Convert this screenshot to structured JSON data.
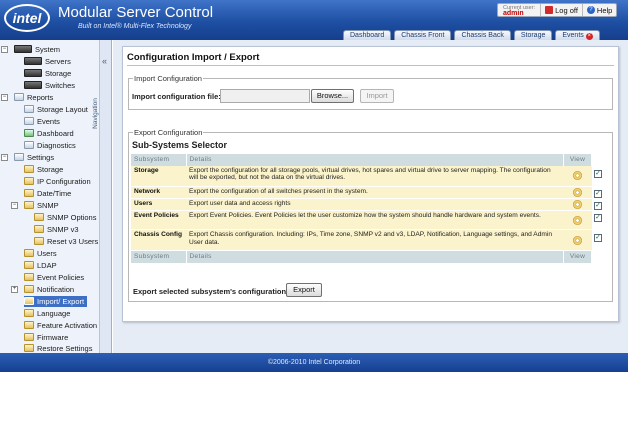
{
  "header": {
    "logo": "intel",
    "title": "Modular Server Control",
    "subtitle": "Built on Intel® Multi-Flex Technology",
    "current_user_label": "Current user:",
    "current_user": "admin",
    "logoff": "Log off",
    "help": "Help",
    "help_icon": "?"
  },
  "tabs": [
    {
      "label": "Dashboard"
    },
    {
      "label": "Chassis Front"
    },
    {
      "label": "Chassis Back"
    },
    {
      "label": "Storage"
    },
    {
      "label": "Events"
    }
  ],
  "tab_close_icon": "×",
  "sidebar": {
    "nav_label": "Navigation",
    "collapse_icon": "«",
    "items": [
      {
        "label": "System",
        "icon": "chassis-icon"
      },
      {
        "label": "Servers",
        "icon": "server-icon"
      },
      {
        "label": "Storage",
        "icon": "storage-icon"
      },
      {
        "label": "Switches",
        "icon": "switch-icon"
      },
      {
        "label": "Reports",
        "icon": "report-icon"
      },
      {
        "label": "Storage Layout",
        "icon": "layout-icon"
      },
      {
        "label": "Events",
        "icon": "events-icon"
      },
      {
        "label": "Dashboard",
        "icon": "dashboard-icon"
      },
      {
        "label": "Diagnostics",
        "icon": "diagnostics-icon"
      },
      {
        "label": "Settings",
        "icon": "settings-icon"
      },
      {
        "label": "Storage",
        "icon": "folder-icon"
      },
      {
        "label": "IP Configuration",
        "icon": "folder-icon"
      },
      {
        "label": "Date/Time",
        "icon": "folder-icon"
      },
      {
        "label": "SNMP",
        "icon": "folder-icon"
      },
      {
        "label": "SNMP Options",
        "icon": "folder-icon"
      },
      {
        "label": "SNMP v3",
        "icon": "folder-icon"
      },
      {
        "label": "Reset v3 Users",
        "icon": "folder-icon"
      },
      {
        "label": "Users",
        "icon": "folder-icon"
      },
      {
        "label": "LDAP",
        "icon": "folder-icon"
      },
      {
        "label": "Event Policies",
        "icon": "folder-icon"
      },
      {
        "label": "Notification",
        "icon": "folder-icon"
      },
      {
        "label": "Import/ Export",
        "icon": "folder-icon"
      },
      {
        "label": "Language",
        "icon": "folder-icon"
      },
      {
        "label": "Feature Activation",
        "icon": "folder-icon"
      },
      {
        "label": "Firmware",
        "icon": "folder-icon"
      },
      {
        "label": "Restore Settings",
        "icon": "folder-icon"
      }
    ],
    "expanders": {
      "minus": "−",
      "plus": "+"
    }
  },
  "main": {
    "title": "Configuration Import / Export",
    "import": {
      "legend": "Import Configuration",
      "label": "Import configuration file:",
      "file_value": "",
      "browse": "Browse...",
      "import": "Import"
    },
    "export": {
      "legend": "Export Configuration",
      "selector_title": "Sub-Systems Selector",
      "col_subsystem": "Subsystem",
      "col_details": "Details",
      "col_view": "View",
      "rows": [
        {
          "name": "Storage",
          "details": "Export the configuration for all storage pools, virtual drives, hot spares and virtual drive to server mapping. The configuration will be exported, but not the data on the virtual drives.",
          "checked": true
        },
        {
          "name": "Network",
          "details": "Export the configuration of all switches present in the system.",
          "checked": true
        },
        {
          "name": "Users",
          "details": "Export user data and access rights",
          "checked": true
        },
        {
          "name": "Event Policies",
          "details": "Export Event Policies. Event Policies let the user customize how the system should handle hardware and system events.",
          "checked": true
        },
        {
          "name": "Chassis Config",
          "details": "Export Chassis configuration. Including: IPs, Time zone, SNMP v2 and v3, LDAP, Notification, Language settings, and Admin User data.",
          "checked": true
        }
      ],
      "check_mark": "✓",
      "export_label": "Export selected subsystem's configuration:",
      "export_button": "Export"
    }
  },
  "footer": {
    "copyright": "©2006-2010 Intel Corporation"
  },
  "colors": {
    "header_blue": "#1e4fa3",
    "selected_nav": "#3d6fc4",
    "row_highlight": "#fbf3cb",
    "table_header": "#cfdde0"
  }
}
